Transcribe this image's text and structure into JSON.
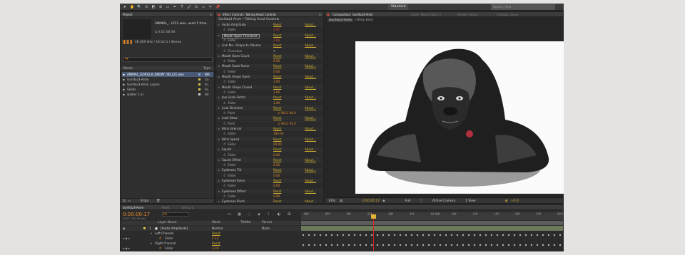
{
  "toolbar": {
    "tools": [
      "arrow-tool-icon",
      "hand-tool-icon",
      "zoom-tool-icon",
      "rotate-tool-icon",
      "camera-tool-icon",
      "pan-behind-icon",
      "rectangle-tool-icon",
      "pen-tool-icon",
      "text-tool-icon",
      "brush-tool-icon",
      "clone-tool-icon",
      "eraser-tool-icon",
      "roto-tool-icon",
      "puppet-tool-icon"
    ],
    "workspace": "Standard",
    "search_placeholder": "Search Help"
  },
  "project_panel": {
    "tab": "Project",
    "preview_name": "ANIMAL_...LY21.wav",
    "preview_used": ", used 1 time",
    "duration": "Δ 0:01:08:08",
    "audio_info": "48.000 kHz / 16 bit U / Stereo",
    "search_placeholder": "P▾",
    "col_name": "Name",
    "col_type": "Type",
    "items": [
      {
        "name": "ANIMAL_GORILLA_ANGRY_YELL21.wav",
        "type": "WA",
        "color": "#7fa7c8",
        "selected": true
      },
      {
        "name": "Gorillaz3-Anim",
        "type": "Co",
        "color": "#d8c34a",
        "selected": false
      },
      {
        "name": "Gorillaz3-Anim Layers",
        "type": "Fo",
        "color": "#d8c34a",
        "selected": false
      },
      {
        "name": "Solids",
        "type": "Fo",
        "color": "#d8c34a",
        "selected": false
      },
      {
        "name": "walker 1.ai",
        "type": "Ad",
        "color": "#cfcfcf",
        "selected": false
      }
    ],
    "bpc": "8 bpc"
  },
  "effect_panel": {
    "tab": "Effect Controls: Talking Head Controls",
    "subtitle": "Gorillaz3-Anim • Talking Head Controls",
    "reset": "Reset",
    "about": "About...",
    "rows": [
      {
        "name": "Audio Amplitude",
        "sub": false
      },
      {
        "name": "Slider",
        "sub": true,
        "value": "2.95",
        "color": "red"
      },
      {
        "name": "Mouth Open Threshold",
        "sub": false,
        "boxed": true
      },
      {
        "name": "Slider",
        "sub": true,
        "value": "2.68",
        "color": "red"
      },
      {
        "name": "Link Mo...Shape to Volume",
        "sub": false
      },
      {
        "name": "Checkbox",
        "sub": true,
        "value": "✔",
        "color": "white"
      },
      {
        "name": "Mouth Open Count",
        "sub": false
      },
      {
        "name": "Slider",
        "sub": true,
        "value": "0.00",
        "color": "orange"
      },
      {
        "name": "Mouth Scale Factor",
        "sub": false
      },
      {
        "name": "Slider",
        "sub": true,
        "value": "0.00",
        "color": "orange"
      },
      {
        "name": "Mouth Shape Open",
        "sub": false
      },
      {
        "name": "Slider",
        "sub": true,
        "value": "1.00",
        "color": "orange"
      },
      {
        "name": "Mouth Shape Closed",
        "sub": false
      },
      {
        "name": "Slider",
        "sub": true,
        "value": "1.00",
        "color": "orange"
      },
      {
        "name": "Jaw Scale Factor",
        "sub": false
      },
      {
        "name": "Slider",
        "sub": true,
        "value": "1.00",
        "color": "orange"
      },
      {
        "name": "Look Direction",
        "sub": false
      },
      {
        "name": "Point",
        "sub": true,
        "value": "◎ 96.0, 86.0",
        "color": "orange"
      },
      {
        "name": "Look Skew",
        "sub": false
      },
      {
        "name": "Point",
        "sub": true,
        "value": "◎ 94.0, 95.0",
        "color": "orange"
      },
      {
        "name": "Blink Interval",
        "sub": false
      },
      {
        "name": "Slider",
        "sub": true,
        "value": "180.00",
        "color": "orange"
      },
      {
        "name": "Blink Speed",
        "sub": false
      },
      {
        "name": "Slider",
        "sub": true,
        "value": "90.00",
        "color": "orange"
      },
      {
        "name": "Squint",
        "sub": false
      },
      {
        "name": "Slider",
        "sub": true,
        "value": "0.00",
        "color": "orange"
      },
      {
        "name": "Squint Offset",
        "sub": false
      },
      {
        "name": "Slider",
        "sub": true,
        "value": "0.00",
        "color": "orange"
      },
      {
        "name": "Eyebrows Tilt",
        "sub": false
      },
      {
        "name": "Slider",
        "sub": true,
        "value": "0.00",
        "color": "orange"
      },
      {
        "name": "Eyebrows Raise",
        "sub": false
      },
      {
        "name": "Slider",
        "sub": true,
        "value": "0.00",
        "color": "orange"
      },
      {
        "name": "Eyebrows Offset",
        "sub": false
      },
      {
        "name": "Slider",
        "sub": true,
        "value": "0.00",
        "color": "orange"
      },
      {
        "name": "Eyebrows Pinch",
        "sub": false
      }
    ]
  },
  "comp_panel": {
    "tab": "Composition: Gorillaz3-Anim",
    "other_tabs": [
      "Layer: Mouth Open 2",
      "Render Queue",
      "Footage: Loose"
    ],
    "breadcrumb_comp": "Gorillaz3-Anim",
    "breadcrumb_layer": "Body back",
    "zoom": "33%",
    "timecode": "0:00:00:17",
    "resolution": "Full",
    "camera": "Active Camera",
    "views": "1 View",
    "exposure": "+0.0"
  },
  "timeline": {
    "tab": "Gorillaz3-Anim",
    "other_tabs": [
      "Head",
      "Group 1"
    ],
    "timecode": "0:00:00:17",
    "frames": "00017 (30.00 fps)",
    "search_placeholder": "P▾",
    "col_layer_name": "Layer Name",
    "col_mode": "Mode",
    "col_trkmat": "TrkMat",
    "col_parent": "Parent",
    "layer": {
      "index": "1",
      "name": "[Audio Amplitude]",
      "mode": "Normal",
      "parent": "None"
    },
    "channels": [
      {
        "name": "Left Channel",
        "reset": "Reset",
        "slider": "Slider",
        "value": "2.11"
      },
      {
        "name": "Right Channel",
        "reset": "Reset",
        "slider": "Slider",
        "value": "3.79"
      }
    ],
    "ruler": [
      "00f",
      "05f",
      "10f",
      "15f",
      "20f",
      "25f",
      "01:00f",
      "05f",
      "10f",
      "15f",
      "20f",
      "25f",
      "02:00f"
    ]
  }
}
